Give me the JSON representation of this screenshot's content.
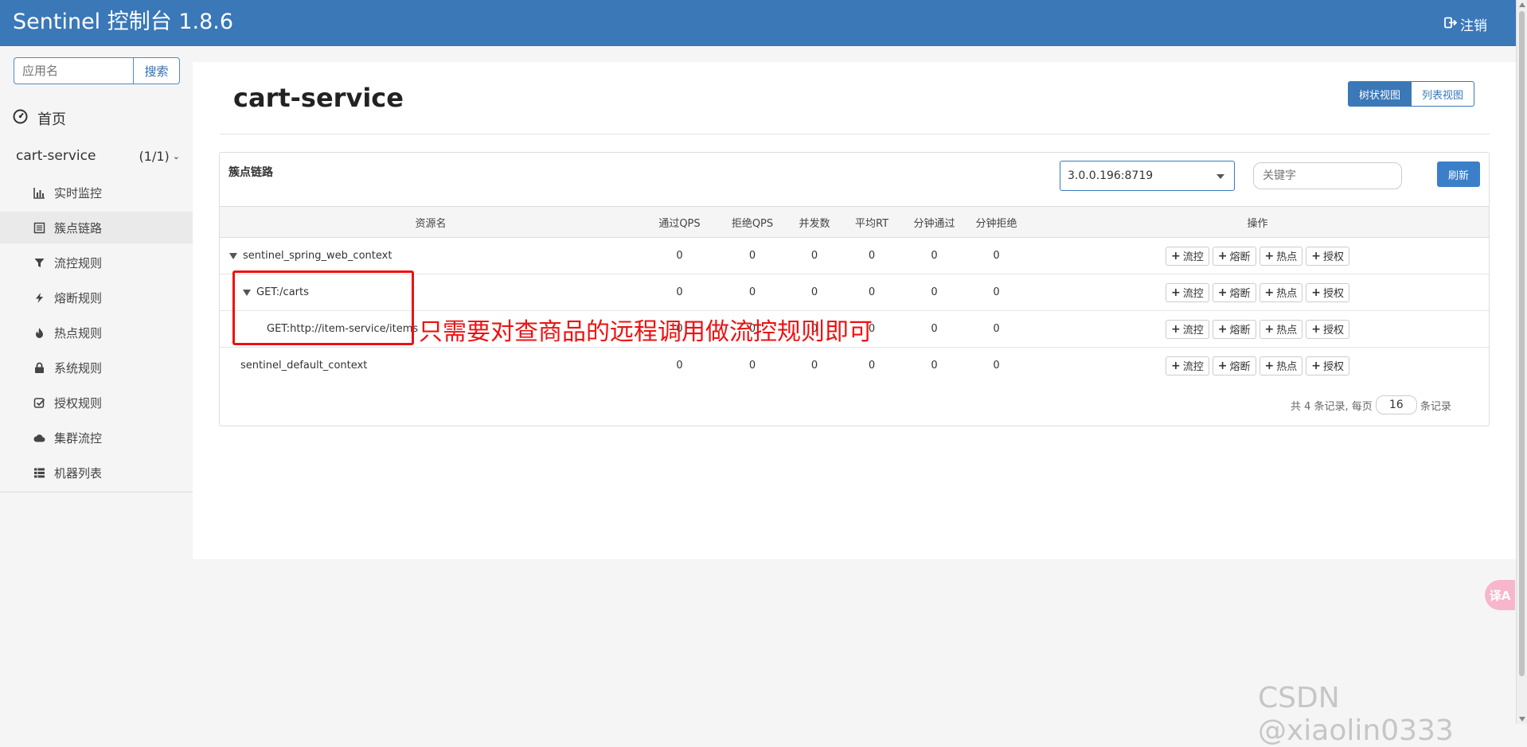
{
  "header": {
    "brand": "Sentinel 控制台 1.8.6",
    "logout_label": "注销",
    "logout_icon": "sign-out-icon",
    "bg_color": "#3a78b8"
  },
  "sidebar": {
    "search_placeholder": "应用名",
    "search_button": "搜索",
    "home_label": "首页",
    "home_icon": "dashboard-icon",
    "app_name": "cart-service",
    "app_count": "(1/1)",
    "menu": [
      {
        "label": "实时监控",
        "icon": "bar-chart-icon"
      },
      {
        "label": "簇点链路",
        "icon": "list-icon",
        "active": true
      },
      {
        "label": "流控规则",
        "icon": "filter-icon"
      },
      {
        "label": "熔断规则",
        "icon": "bolt-icon"
      },
      {
        "label": "热点规则",
        "icon": "fire-icon"
      },
      {
        "label": "系统规则",
        "icon": "lock-icon"
      },
      {
        "label": "授权规则",
        "icon": "check-square-icon"
      },
      {
        "label": "集群流控",
        "icon": "cloud-icon"
      },
      {
        "label": "机器列表",
        "icon": "th-list-icon"
      }
    ]
  },
  "main": {
    "title": "cart-service",
    "view_tree": "树状视图",
    "view_list": "列表视图",
    "panel_label": "簇点链路",
    "machine": "3.0.0.196:8719",
    "keyword_placeholder": "关键字",
    "refresh": "刷新",
    "columns": [
      "资源名",
      "通过QPS",
      "拒绝QPS",
      "并发数",
      "平均RT",
      "分钟通过",
      "分钟拒绝",
      "操作"
    ],
    "ops": [
      "流控",
      "熔断",
      "热点",
      "授权"
    ],
    "rows": [
      {
        "name": "sentinel_spring_web_context",
        "pass_qps": "0",
        "block_qps": "0",
        "threads": "0",
        "avg_rt": "0",
        "min_pass": "0",
        "min_block": "0"
      },
      {
        "name": "GET:/carts",
        "pass_qps": "0",
        "block_qps": "0",
        "threads": "0",
        "avg_rt": "0",
        "min_pass": "0",
        "min_block": "0"
      },
      {
        "name": "GET:http://item-service/items",
        "pass_qps": "0",
        "block_qps": "0",
        "threads": "0",
        "avg_rt": "0",
        "min_pass": "0",
        "min_block": "0"
      },
      {
        "name": "sentinel_default_context",
        "pass_qps": "0",
        "block_qps": "0",
        "threads": "0",
        "avg_rt": "0",
        "min_pass": "0",
        "min_block": "0"
      }
    ],
    "pager_prefix": "共 4 条记录, 每页",
    "page_size": "16",
    "pager_suffix": "条记录"
  },
  "annotation": {
    "text": "只需要对查商品的远程调用做流控规则即可",
    "color": "#ee1111"
  },
  "floating_translate": "译A",
  "watermark": "CSDN @xiaolin0333"
}
